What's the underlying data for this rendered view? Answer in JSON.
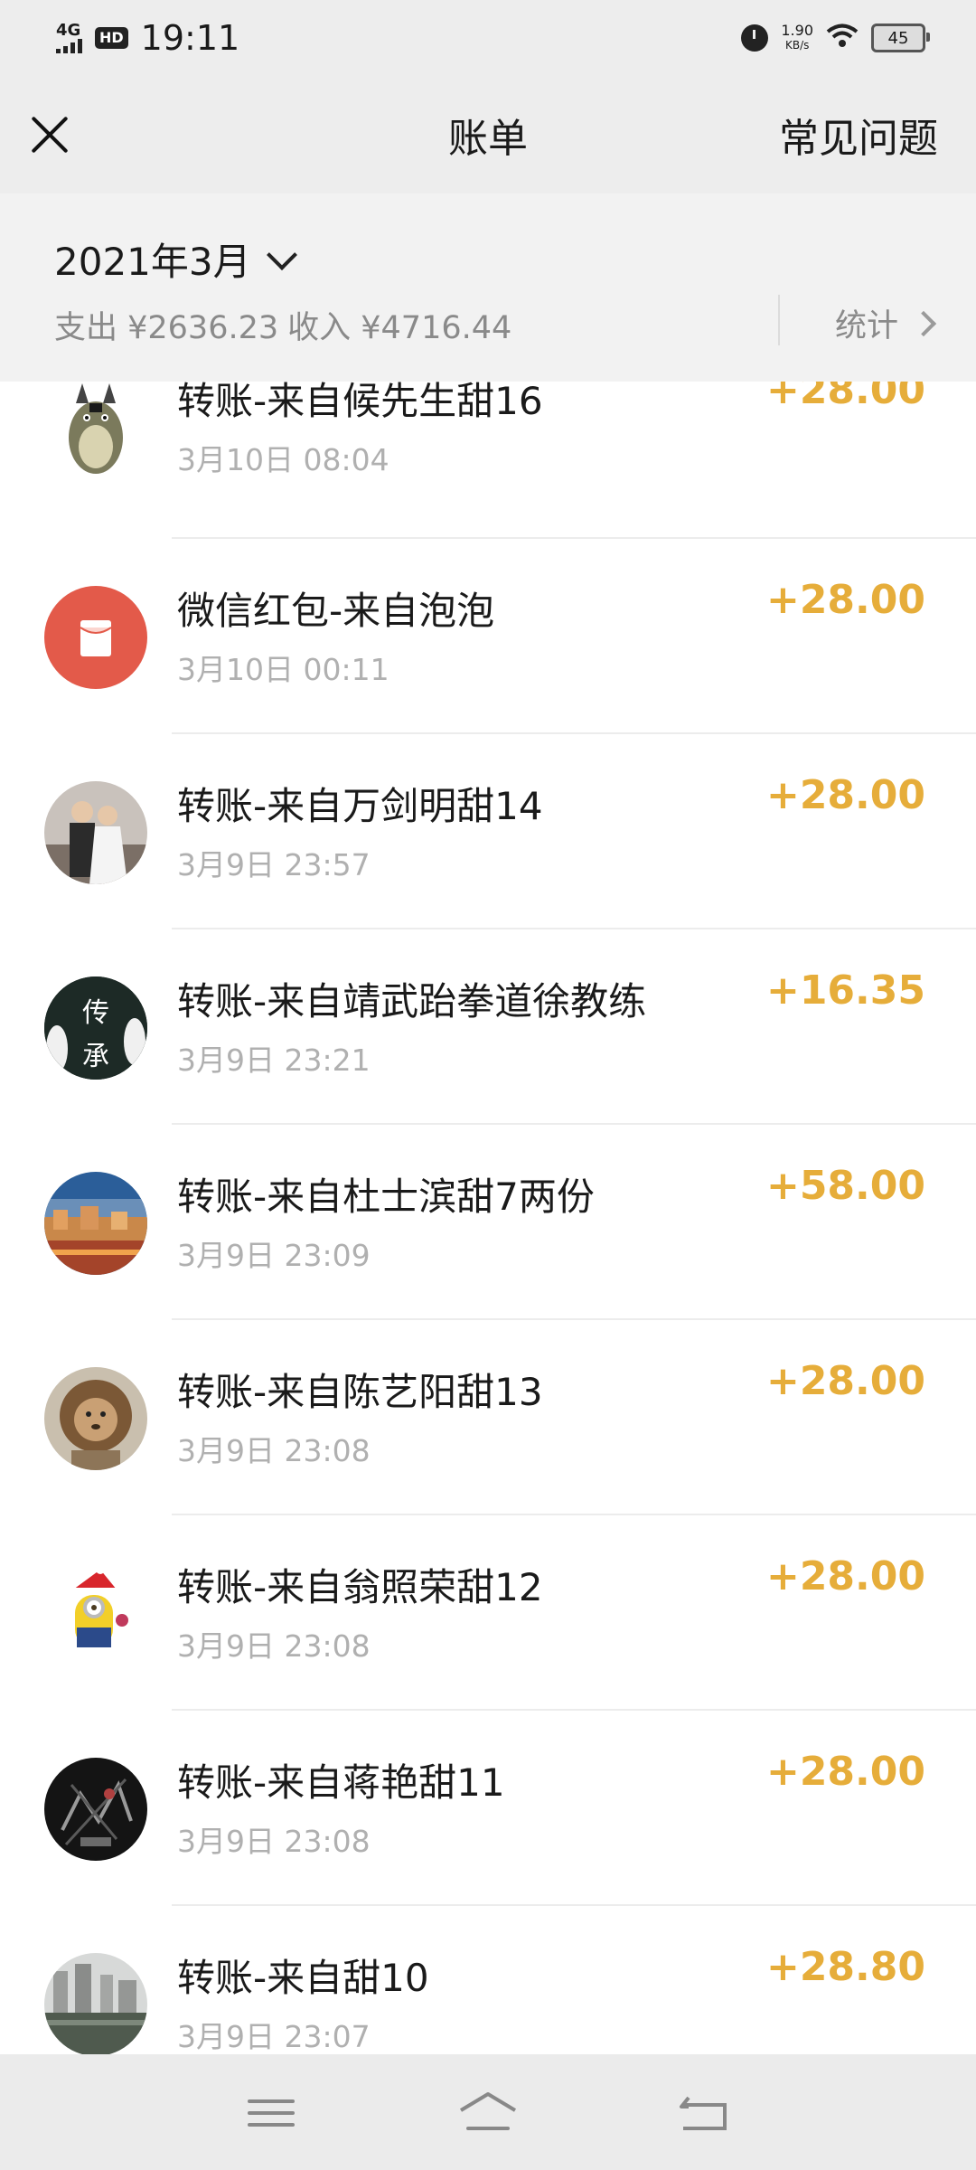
{
  "status_bar": {
    "network": "4G",
    "hd": "HD",
    "time": "19:11",
    "speed_value": "1.90",
    "speed_unit": "KB/s",
    "battery": "45"
  },
  "header": {
    "title": "账单",
    "faq_label": "常见问题"
  },
  "summary": {
    "month": "2021年3月",
    "expense_label": "支出 ¥2636.23",
    "income_label": "收入 ¥4716.44",
    "stats_label": "统计"
  },
  "transactions": [
    {
      "title": "转账-来自候先生甜16",
      "time": "3月10日 08:04",
      "amount": "+28.00",
      "avatar": "totoro"
    },
    {
      "title": "微信红包-来自泡泡",
      "time": "3月10日 00:11",
      "amount": "+28.00",
      "avatar": "red-packet"
    },
    {
      "title": "转账-来自万剑明甜14",
      "time": "3月9日 23:57",
      "amount": "+28.00",
      "avatar": "wedding-photo"
    },
    {
      "title": "转账-来自靖武跆拳道徐教练",
      "time": "3月9日 23:21",
      "amount": "+16.35",
      "avatar": "chuan-cheng"
    },
    {
      "title": "转账-来自杜士滨甜7两份",
      "time": "3月9日 23:09",
      "amount": "+58.00",
      "avatar": "night-city"
    },
    {
      "title": "转账-来自陈艺阳甜13",
      "time": "3月9日 23:08",
      "amount": "+28.00",
      "avatar": "lion"
    },
    {
      "title": "转账-来自翁照荣甜12",
      "time": "3月9日 23:08",
      "amount": "+28.00",
      "avatar": "minion"
    },
    {
      "title": "转账-来自蒋艳甜11",
      "time": "3月9日 23:08",
      "amount": "+28.00",
      "avatar": "dark-art"
    },
    {
      "title": "转账-来自甜10",
      "time": "3月9日 23:07",
      "amount": "+28.80",
      "avatar": "lake-buildings"
    }
  ],
  "avatar_text": {
    "chuan": "传",
    "cheng": "承"
  },
  "colors": {
    "amount": "#e6ad3a",
    "secondary_text": "#b0b0b0",
    "header_bg": "#ededed",
    "red_packet": "#e35a4a"
  },
  "icons": [
    "close-icon",
    "chevron-down-icon",
    "chevron-right-icon",
    "menu-icon",
    "home-icon",
    "back-icon",
    "wifi-icon",
    "alarm-icon",
    "battery-icon"
  ]
}
